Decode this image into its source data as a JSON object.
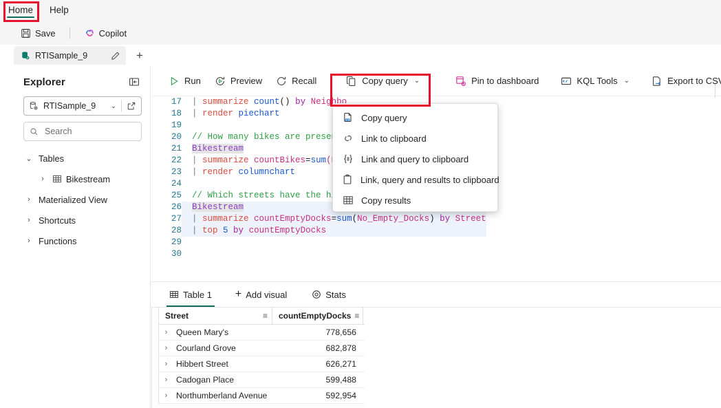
{
  "ribbon": {
    "tabs": [
      {
        "label": "Home",
        "active": true
      },
      {
        "label": "Help",
        "active": false
      }
    ],
    "commands": [
      {
        "label": "Save",
        "icon": "save-icon"
      },
      {
        "label": "Copilot",
        "icon": "copilot-icon"
      }
    ]
  },
  "query_tab": {
    "name": "RTISample_9",
    "rename_icon": "pencil-icon",
    "add_label": "+"
  },
  "explorer": {
    "title": "Explorer",
    "collapse_icon": "collapse-panel-icon",
    "database": "RTISample_9",
    "open_icon": "open-in-new-icon",
    "search_placeholder": "Search",
    "search_value": "",
    "tree": [
      {
        "label": "Tables",
        "level": 1,
        "expanded": true,
        "icon": ""
      },
      {
        "label": "Bikestream",
        "level": 2,
        "expanded": false,
        "icon": "table-icon"
      },
      {
        "label": "Materialized View",
        "level": 1,
        "expanded": false,
        "icon": ""
      },
      {
        "label": "Shortcuts",
        "level": 1,
        "expanded": false,
        "icon": ""
      },
      {
        "label": "Functions",
        "level": 1,
        "expanded": false,
        "icon": ""
      }
    ]
  },
  "query_toolbar": {
    "run": "Run",
    "preview": "Preview",
    "recall": "Recall",
    "copy_query": "Copy query",
    "pin_to_dashboard": "Pin to dashboard",
    "kql_tools": "KQL Tools",
    "export_to_csv": "Export to CSV"
  },
  "copy_menu": {
    "items": [
      {
        "label": "Copy query",
        "icon": "copy-query-icon"
      },
      {
        "label": "Link to clipboard",
        "icon": "link-icon"
      },
      {
        "label": "Link and query to clipboard",
        "icon": "braces-icon"
      },
      {
        "label": "Link, query and results to clipboard",
        "icon": "clipboard-icon"
      },
      {
        "label": "Copy results",
        "icon": "grid-icon"
      }
    ]
  },
  "code": {
    "lines": [
      {
        "num": "17",
        "segments": [
          {
            "t": "  | ",
            "c": "k-pipe"
          },
          {
            "t": "summarize ",
            "c": "k-cmd"
          },
          {
            "t": "count",
            "c": "k-fn"
          },
          {
            "t": "() ",
            "c": "k-plain"
          },
          {
            "t": "by ",
            "c": "k-by"
          },
          {
            "t": "Neighbo",
            "c": "k-col"
          }
        ]
      },
      {
        "num": "18",
        "segments": [
          {
            "t": "  | ",
            "c": "k-pipe"
          },
          {
            "t": "render ",
            "c": "k-cmd"
          },
          {
            "t": "piechart",
            "c": "k-fn"
          }
        ]
      },
      {
        "num": "19",
        "segments": []
      },
      {
        "num": "20",
        "segments": [
          {
            "t": "  // How many bikes are present ",
            "c": "k-com"
          }
        ]
      },
      {
        "num": "21",
        "segments": [
          {
            "t": "  ",
            "c": "k-plain"
          },
          {
            "t": "Bikestream",
            "c": "k-tbl"
          }
        ]
      },
      {
        "num": "22",
        "segments": [
          {
            "t": "  | ",
            "c": "k-pipe"
          },
          {
            "t": "summarize ",
            "c": "k-cmd"
          },
          {
            "t": "countBikes",
            "c": "k-col"
          },
          {
            "t": "=",
            "c": "k-plain"
          },
          {
            "t": "sum",
            "c": "k-fn"
          },
          {
            "t": "(No_",
            "c": "k-col"
          }
        ]
      },
      {
        "num": "23",
        "segments": [
          {
            "t": "  | ",
            "c": "k-pipe"
          },
          {
            "t": "render ",
            "c": "k-cmd"
          },
          {
            "t": "columnchart",
            "c": "k-fn"
          }
        ]
      },
      {
        "num": "24",
        "segments": []
      },
      {
        "num": "25",
        "segments": [
          {
            "t": "  // Which streets have the high",
            "c": "k-com"
          }
        ]
      },
      {
        "num": "26",
        "segments": [
          {
            "t": "  ",
            "c": "k-plain"
          },
          {
            "t": "Bikestream",
            "c": "k-tbl"
          }
        ]
      },
      {
        "num": "27",
        "segments": [
          {
            "t": "  | ",
            "c": "k-pipe"
          },
          {
            "t": "summarize ",
            "c": "k-cmd"
          },
          {
            "t": "countEmptyDocks",
            "c": "k-col"
          },
          {
            "t": "=",
            "c": "k-plain"
          },
          {
            "t": "sum",
            "c": "k-fn"
          },
          {
            "t": "(",
            "c": "k-plain"
          },
          {
            "t": "No_Empty_Docks",
            "c": "k-col"
          },
          {
            "t": ") ",
            "c": "k-plain"
          },
          {
            "t": "by ",
            "c": "k-by"
          },
          {
            "t": "Street",
            "c": "k-col"
          }
        ]
      },
      {
        "num": "28",
        "segments": [
          {
            "t": "  | ",
            "c": "k-pipe"
          },
          {
            "t": "top ",
            "c": "k-cmd"
          },
          {
            "t": "5 ",
            "c": "k-num"
          },
          {
            "t": "by ",
            "c": "k-by"
          },
          {
            "t": "countEmptyDocks",
            "c": "k-col"
          }
        ]
      },
      {
        "num": "29",
        "segments": []
      },
      {
        "num": "30",
        "segments": []
      }
    ]
  },
  "results": {
    "tabs": [
      {
        "label": "Table 1",
        "icon": "table-grid-icon",
        "active": true
      },
      {
        "label": "Add visual",
        "icon": "plus-icon",
        "active": false
      },
      {
        "label": "Stats",
        "icon": "stats-icon",
        "active": false
      }
    ],
    "columns": [
      "Street",
      "countEmptyDocks"
    ],
    "rows": [
      {
        "street": "Queen Mary's",
        "count": "778,656"
      },
      {
        "street": "Courland Grove",
        "count": "682,878"
      },
      {
        "street": "Hibbert Street",
        "count": "626,271"
      },
      {
        "street": "Cadogan Place",
        "count": "599,488"
      },
      {
        "street": "Northumberland Avenue",
        "count": "592,954"
      }
    ]
  },
  "colors": {
    "accent": "#0f6b5c",
    "annotation": "#e8112d",
    "link": "#1a56d6",
    "comment": "#2f9e44"
  }
}
